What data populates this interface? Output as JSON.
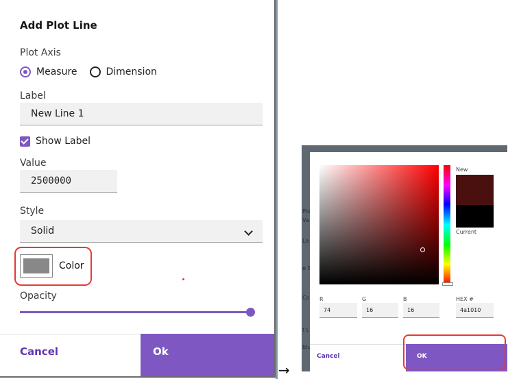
{
  "add_plot_line": {
    "title": "Add Plot Line",
    "plot_axis_label": "Plot Axis",
    "plot_axis_options": [
      "Measure",
      "Dimension"
    ],
    "plot_axis_selected": "Measure",
    "label_label": "Label",
    "label_value": "New Line 1",
    "show_label_text": "Show Label",
    "show_label_checked": true,
    "value_label": "Value",
    "value_value": "2500000",
    "style_label": "Style",
    "style_value": "Solid",
    "color_label": "Color",
    "color_swatch": "#888888",
    "opacity_label": "Opacity",
    "opacity_level": 1.0,
    "cancel_label": "Cancel",
    "ok_label": "Ok"
  },
  "arrow": "→",
  "color_picker": {
    "new_label": "New",
    "current_label": "Current",
    "new_color": "#4a1010",
    "current_color": "#000000",
    "r_label": "R",
    "g_label": "G",
    "b_label": "B",
    "hex_label": "HEX #",
    "r_value": "74",
    "g_value": "16",
    "b_value": "16",
    "hex_value": "4a1010",
    "cancel_label": "Cancel",
    "ok_label": "OK",
    "peek_labels": [
      "Plot",
      "Va",
      "La",
      "e S",
      "Co",
      "t L",
      "blu",
      "bel"
    ]
  },
  "colors": {
    "accent": "#7e57c2",
    "highlight": "#e53935"
  }
}
